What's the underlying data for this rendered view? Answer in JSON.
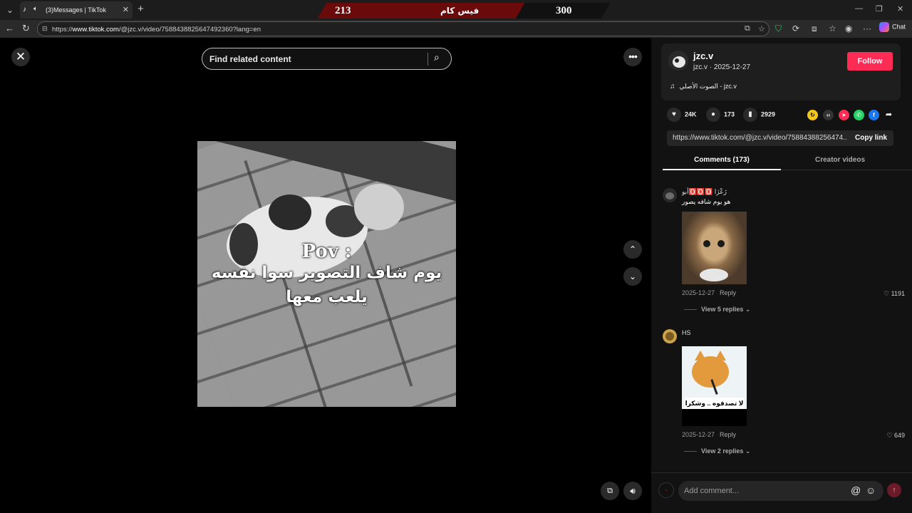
{
  "browser": {
    "tab_title": "(3)Messages | TikTok",
    "url_prefix": "https://",
    "url_domain": "www.tiktok.com",
    "url_path": "/@jzc.v/video/7588438825647492360?lang=en",
    "chat_label": "Chat"
  },
  "overlay": {
    "score_left": "213",
    "score_center": "فيس كام",
    "score_right": "300"
  },
  "video": {
    "search_placeholder": "Find related content",
    "caption_en": "Pov :",
    "caption_ar_line1": "يوم شاف التصوير سوا نفسه",
    "caption_ar_line2": "يلعب معها"
  },
  "creator": {
    "username": "jzc.v",
    "handle_date": "jzc.v · 2025-12-27",
    "follow_label": "Follow",
    "music": "الصوت الأصلي - jzc.v"
  },
  "stats": {
    "likes": "24K",
    "comments": "173",
    "saves": "2929"
  },
  "link": {
    "url": "https://www.tiktok.com/@jzc.v/video/75884388256474...",
    "copy_label": "Copy link"
  },
  "tabs": {
    "comments": "Comments (173)",
    "creator_videos": "Creator videos"
  },
  "comments": [
    {
      "author": "أبو🅾️🅾️🅾️ زَعْزَا",
      "text": "هو يوم شافه يصور",
      "date": "2025-12-27",
      "reply_label": "Reply",
      "likes": "1191",
      "view_replies": "View 5 replies"
    },
    {
      "author": "HS",
      "image_caption": "لا تصدقوه .. وشكرا",
      "date": "2025-12-27",
      "reply_label": "Reply",
      "likes": "649",
      "view_replies": "View 2 replies"
    }
  ],
  "add_comment": {
    "placeholder": "Add comment..."
  },
  "colors": {
    "follow": "#fe2c55",
    "background": "#000000",
    "panel": "#121212"
  }
}
